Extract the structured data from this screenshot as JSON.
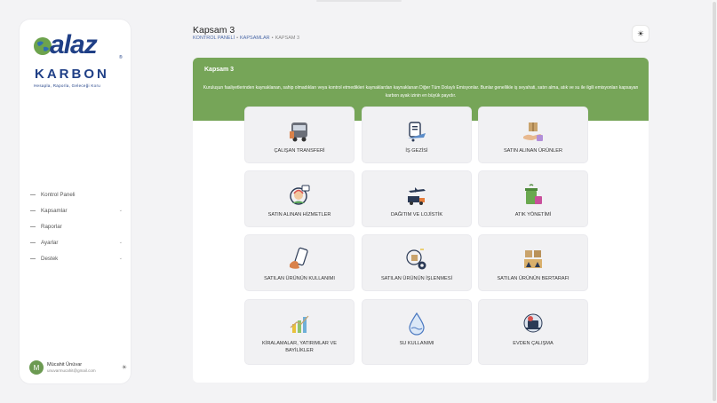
{
  "logo": {
    "main": "alaz",
    "sub": "KARBON",
    "tagline": "Hesapla, Raporla, Geleceği Koru",
    "reg": "®"
  },
  "nav": {
    "items": [
      {
        "label": "Kontrol Paneli",
        "chevron": ""
      },
      {
        "label": "Kapsamlar",
        "chevron": "⌄"
      },
      {
        "label": "Raporlar",
        "chevron": ""
      },
      {
        "label": "Ayarlar",
        "chevron": "⌄"
      },
      {
        "label": "Destek",
        "chevron": "⌄"
      }
    ]
  },
  "user": {
    "initial": "M",
    "name": "Mücahit Ünüvar",
    "email": "unuvarmucahit@gmail.com",
    "theme_icon": "☀"
  },
  "header": {
    "title": "Kapsam 3",
    "breadcrumb": [
      "KONTROL PANELİ",
      "KAPSAMLAR",
      "KAPSAM 3"
    ],
    "separator": "•",
    "theme_icon": "☀"
  },
  "hero": {
    "title": "Kapsam 3",
    "text": "Kuruluşun faaliyetlerinden kaynaklanan, sahip olmadıkları veya kontrol etmedikleri kaynaklardan kaynaklanan Diğer Tüm Dolaylı Emisyonlar. Bunlar genellikle iş seyahati, satın alma, atık ve su ile ilgili emisyonları kapsayan karbon ayak izinin en büyük payıdır."
  },
  "tiles": [
    {
      "label": "ÇALIŞAN TRANSFERİ",
      "icon": "bus-icon"
    },
    {
      "label": "İŞ GEZİSİ",
      "icon": "travel-icon"
    },
    {
      "label": "SATIN ALINAN ÜRÜNLER",
      "icon": "package-icon"
    },
    {
      "label": "SATIN ALINAN HİZMETLER",
      "icon": "support-agent-icon"
    },
    {
      "label": "DAĞITIM VE LOJİSTİK",
      "icon": "logistics-icon"
    },
    {
      "label": "ATIK YÖNETİMİ",
      "icon": "waste-bin-icon"
    },
    {
      "label": "SATILAN ÜRÜNÜN KULLANIMI",
      "icon": "phone-hand-icon"
    },
    {
      "label": "SATILAN ÜRÜNÜN İŞLENMESİ",
      "icon": "processing-icon"
    },
    {
      "label": "SATILAN ÜRÜNÜN BERTARAFI",
      "icon": "disposal-boxes-icon"
    },
    {
      "label": "KİRALAMALAR, YATIRIMLAR VE BAYİLİKLER",
      "icon": "investment-chart-icon"
    },
    {
      "label": "SU KULLANIMI",
      "icon": "water-drop-icon"
    },
    {
      "label": "EVDEN ÇALIŞMA",
      "icon": "remote-work-icon"
    }
  ]
}
